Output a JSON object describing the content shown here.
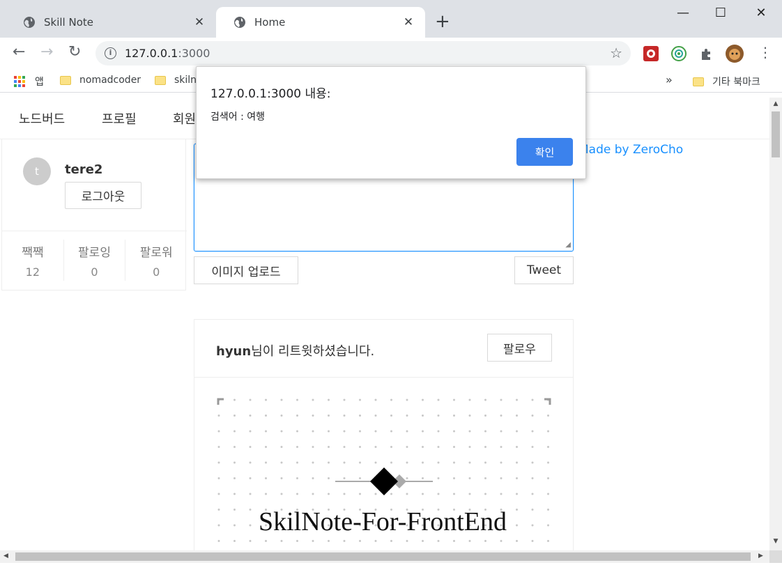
{
  "browser": {
    "tabs": [
      {
        "title": "Skill Note",
        "close": "✕"
      },
      {
        "title": "Home",
        "close": "✕"
      }
    ],
    "new_tab": "+",
    "window_controls": {
      "minimize": "—",
      "maximize": "☐",
      "close": "✕"
    },
    "nav": {
      "back": "←",
      "forward": "→",
      "reload": "↻"
    },
    "url_host": "127.0.0.1",
    "url_port": ":3000",
    "bookmarks": [
      {
        "label": "앱",
        "icon": "apps-grid-icon"
      },
      {
        "label": "nomadcoder",
        "icon": "folder-icon"
      },
      {
        "label": "skiln",
        "icon": "folder-icon"
      }
    ],
    "bookmarks_overflow": "»",
    "other_bookmarks": "기타 북마크"
  },
  "page": {
    "menu": [
      "노드버드",
      "프로필",
      "회원"
    ],
    "made_by": "Made by ZeroCho",
    "profile": {
      "avatar_letter": "t",
      "nickname": "tere2",
      "logout_label": "로그아웃",
      "stats": [
        {
          "label": "짹짹",
          "value": "12"
        },
        {
          "label": "팔로잉",
          "value": "0"
        },
        {
          "label": "팔로워",
          "value": "0"
        }
      ]
    },
    "form": {
      "upload_label": "이미지 업로드",
      "tweet_label": "Tweet"
    },
    "post": {
      "author": "hyun",
      "retweet_text": "님이 리트윗하셨습니다.",
      "follow_label": "팔로우",
      "image_text": "SkilNote-For-FrontEnd"
    }
  },
  "alert": {
    "title": "127.0.0.1:3000 내용:",
    "message": "검색어 : 여행",
    "ok_label": "확인"
  },
  "colors": {
    "accent": "#1890ff",
    "alert_button": "#3b82ed",
    "tabstrip": "#dee1e6"
  }
}
